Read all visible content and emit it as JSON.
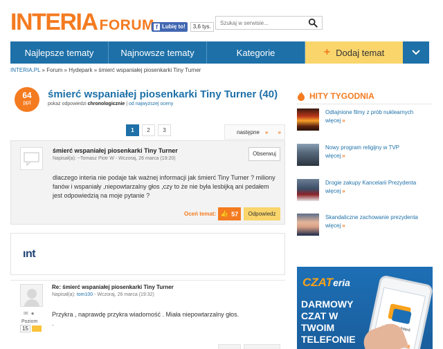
{
  "header": {
    "logo_main": "INTERIA",
    "logo_sub": "FORUM",
    "fb_like": "Lubię to!",
    "fb_count": "3,6 tys.",
    "search_placeholder": "Szukaj w serwisie..."
  },
  "nav": {
    "items": [
      "Najlepsze tematy",
      "Najnowsze tematy",
      "Kategorie"
    ],
    "add_label": "Dodaj temat"
  },
  "breadcrumb": [
    "INTERIA.PL",
    "Forum",
    "Hydepark",
    "śmierć wspaniałej piosenkarki Tiny Turner"
  ],
  "topic": {
    "points": "64",
    "points_unit": "ppt",
    "title": "śmierć wspaniałej piosenkarki Tiny Turner (40)",
    "sort_prefix": "pokaż odpowiedzi",
    "sort_active": "chronologicznie",
    "sort_sep": "|",
    "sort_alt": "od najwyższej oceny"
  },
  "pagination": {
    "pages": [
      "1",
      "2",
      "3"
    ],
    "next": "następne"
  },
  "post1": {
    "title": "śmierć wspaniałej piosenkarki Tiny Turner",
    "meta": "Napisał(a): ~Tomasz Piotr W - Wczoraj, 26 marca (19:20)",
    "follow": "Obserwuj",
    "body": "dlaczego interia nie podaje tak ważnej informacji jak śmierć Tiny Turner ? miliony fanów i wspaniały ,niepowtarzalny głos ,czy to że nie była lesbijką ani pedałem jest odpowiedzią na moje pytanie ?",
    "rate_label": "Oceń temat:",
    "rate_count": "57",
    "reply": "Odpowiedz"
  },
  "ad_logo": "ınt",
  "post2": {
    "title": "Re: śmierć wspaniałej piosenkarki Tiny Turner",
    "meta_prefix": "Napisał(a):",
    "user": "tom100",
    "meta_suffix": "- Wczoraj, 26 marca (19:32)",
    "body": "Przykra , naprawdę przykra wiadomość . Miała niepowtarzalny głos.",
    "body2": ".",
    "level_label": "Poziom",
    "level": "15"
  },
  "sidebar": {
    "hits_title": "HITY TYGODNIA",
    "more": "więcej",
    "hits": [
      {
        "title": "Odtajnione filmy z prób nuklearnych",
        "thumb": "nuke"
      },
      {
        "title": "Nowy program religijny w TVP",
        "thumb": "man"
      },
      {
        "title": "Drogie zakupy Kancelarii Prezydenta",
        "thumb": "pres"
      },
      {
        "title": "Skandaliczne zachowanie prezydenta",
        "thumb": "trump"
      }
    ]
  },
  "czat_ad": {
    "logo_a": "CZAT",
    "logo_b": "eria",
    "line1": "DARMOWY",
    "line2": "CZAT W",
    "line3": "TWOIM",
    "line4": "TELEFONIE",
    "phone_text": "...cczat w Interii",
    "phone_logo": "CZAT eria"
  },
  "colors": {
    "brand_orange": "#f47b20",
    "nav_blue": "#1d70a8",
    "add_yellow": "#f9d56b"
  },
  "icons": [
    "search-icon",
    "facebook-icon",
    "flame-icon",
    "thumb-up-icon",
    "chevron-down-icon",
    "mail-icon",
    "user-icon"
  ]
}
